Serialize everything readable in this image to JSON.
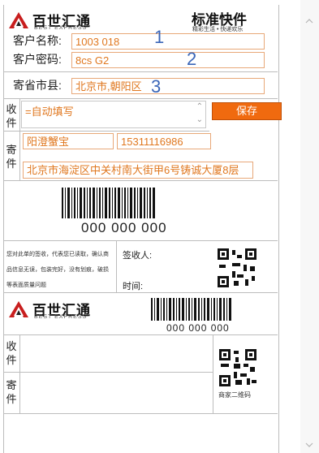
{
  "brand": {
    "logo_cn": "百世汇通",
    "logo_en": "BEST EXPRESS",
    "slogan_title": "标准快件",
    "slogan_sub": "精彩生活 • 快递欢乐"
  },
  "form": {
    "customer_name_label": "客户名称:",
    "customer_name_value": "1003      018",
    "customer_pwd_label": "客户密码:",
    "customer_pwd_value": "8cs           G2",
    "origin_label": "寄省市县:",
    "origin_value": "北京市,朝阳区",
    "annotations": [
      "1",
      "2",
      "3"
    ]
  },
  "receiver": {
    "label_top": "收件",
    "textarea_value": "=自动填写",
    "save_button": "保存"
  },
  "sender": {
    "label": "寄件",
    "name": "阳澄蟹宝",
    "phone": "15311116986",
    "address": "北京市海淀区中关村南大街甲6号铸诚大厦8层"
  },
  "barcode": {
    "number": "000 000 000",
    "small_number": "000 000 000"
  },
  "sign": {
    "disclaimer": "您对此单的签收，代表您已读取，确认商品信息无误，包装完好，没有划痕，破损等表面质量问题",
    "signer_label": "签收人:",
    "time_label": "时间:"
  },
  "stub": {
    "receive_label": "收件",
    "send_label": "寄件",
    "qr_caption": "商家二维码"
  },
  "scrollbar": {
    "down_arrow": "⌄"
  }
}
